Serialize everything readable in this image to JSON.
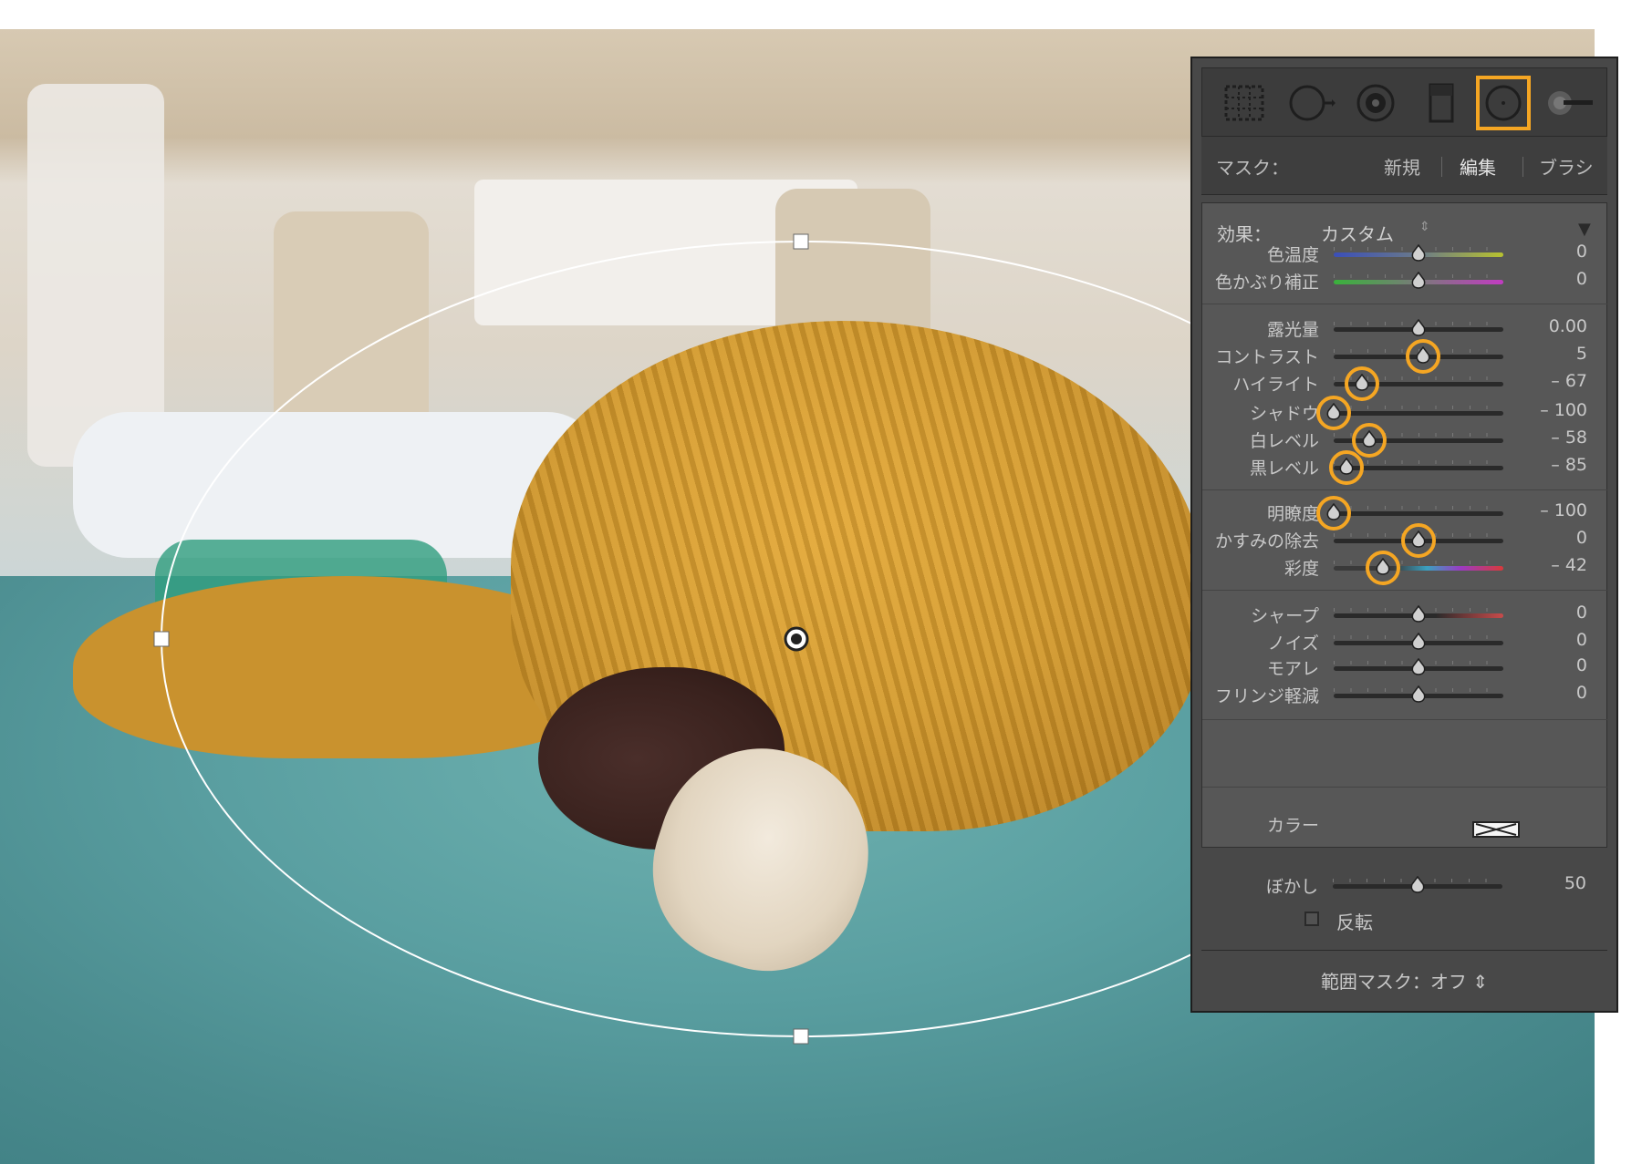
{
  "colors": {
    "accent": "#f5a623",
    "panel_bg": "#484848",
    "panel_section_bg": "#575757",
    "text": "#c8c8c8"
  },
  "photo": {
    "content": "dog-under-sweater-in-car"
  },
  "toolbar": {
    "tools": [
      {
        "icon": "crop-overlay-icon"
      },
      {
        "icon": "spot-removal-icon"
      },
      {
        "icon": "red-eye-icon"
      },
      {
        "icon": "graduated-filter-icon"
      },
      {
        "icon": "radial-filter-icon",
        "active": true
      },
      {
        "icon": "adjustment-brush-icon"
      }
    ]
  },
  "mask": {
    "label": "マスク：",
    "new": "新規",
    "edit": "編集",
    "brush": "ブラシ"
  },
  "effect": {
    "label": "効果：",
    "value": "カスタム",
    "arrows": "⇕",
    "collapse": "▼"
  },
  "sliders": {
    "wb": [
      {
        "label": "色温度",
        "value": "0",
        "position": 0.5,
        "track": "temp",
        "highlighted": false
      },
      {
        "label": "色かぶり補正",
        "value": "0",
        "position": 0.5,
        "track": "tint",
        "highlighted": false
      }
    ],
    "tone": [
      {
        "label": "露光量",
        "value": "0.00",
        "position": 0.5,
        "track": "dark",
        "highlighted": false
      },
      {
        "label": "コントラスト",
        "value": "5",
        "position": 0.525,
        "track": "dark",
        "highlighted": true
      },
      {
        "label": "ハイライト",
        "value": "– 67",
        "position": 0.165,
        "track": "dark",
        "highlighted": true
      },
      {
        "label": "シャドウ",
        "value": "– 100",
        "position": 0.0,
        "track": "dark",
        "highlighted": true
      },
      {
        "label": "白レベル",
        "value": "– 58",
        "position": 0.21,
        "track": "dark",
        "highlighted": true
      },
      {
        "label": "黒レベル",
        "value": "– 85",
        "position": 0.075,
        "track": "dark",
        "highlighted": true
      }
    ],
    "presence": [
      {
        "label": "明瞭度",
        "value": "– 100",
        "position": 0.0,
        "track": "dark",
        "highlighted": true
      },
      {
        "label": "かすみの除去",
        "value": "0",
        "position": 0.5,
        "track": "dark",
        "highlighted": true
      },
      {
        "label": "彩度",
        "value": "– 42",
        "position": 0.29,
        "track": "saturation",
        "highlighted": true
      }
    ],
    "detail": [
      {
        "label": "シャープ",
        "value": "0",
        "position": 0.5,
        "track": "sharp",
        "highlighted": false
      },
      {
        "label": "ノイズ",
        "value": "0",
        "position": 0.5,
        "track": "dark",
        "highlighted": false
      },
      {
        "label": "モアレ",
        "value": "0",
        "position": 0.5,
        "track": "dark",
        "highlighted": false
      },
      {
        "label": "フリンジ軽減",
        "value": "0",
        "position": 0.5,
        "track": "dark",
        "highlighted": false
      }
    ]
  },
  "color": {
    "label": "カラー"
  },
  "feather": {
    "label": "ぼかし",
    "value": "50",
    "position": 0.5
  },
  "invert": {
    "label": "反転",
    "checked": false
  },
  "range_mask": {
    "label": "範囲マスク：オフ ⇕"
  }
}
